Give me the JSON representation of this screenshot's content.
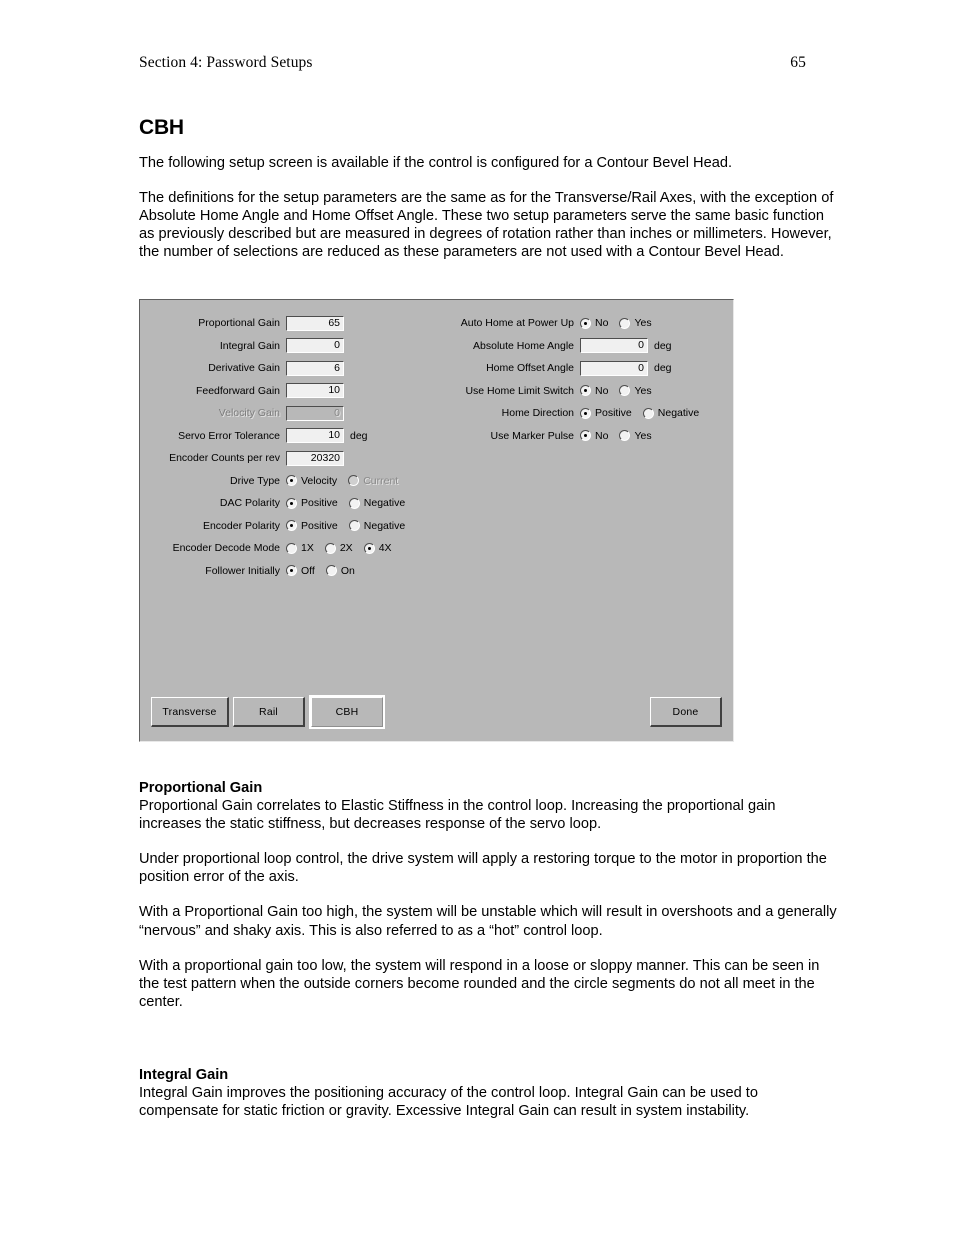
{
  "header": {
    "section": "Section 4: Password Setups",
    "page_number": "65"
  },
  "chapter_title": "CBH",
  "intro": {
    "p1": "The following setup screen is available if the control is configured for a Contour Bevel Head.",
    "p2": "The definitions for the setup parameters are the same as for the Transverse/Rail Axes, with the exception of Absolute Home Angle and Home Offset Angle.  These two setup parameters serve the same basic function as previously described but are measured in degrees of rotation rather than inches or millimeters.  However, the number of selections are reduced as these parameters are not used with a Contour Bevel Head."
  },
  "dialog": {
    "left_column": {
      "proportional_gain": {
        "label": "Proportional Gain",
        "value": "65"
      },
      "integral_gain": {
        "label": "Integral Gain",
        "value": "0"
      },
      "derivative_gain": {
        "label": "Derivative Gain",
        "value": "6"
      },
      "feedforward_gain": {
        "label": "Feedforward Gain",
        "value": "10"
      },
      "velocity_gain": {
        "label": "Velocity Gain",
        "value": "0"
      },
      "servo_error_tolerance": {
        "label": "Servo Error Tolerance",
        "value": "10",
        "unit": "deg"
      },
      "encoder_counts_per_rev": {
        "label": "Encoder Counts per rev",
        "value": "20320"
      },
      "drive_type": {
        "label": "Drive Type",
        "option1": "Velocity",
        "option2": "Current"
      },
      "dac_polarity": {
        "label": "DAC Polarity",
        "option1": "Positive",
        "option2": "Negative"
      },
      "encoder_polarity": {
        "label": "Encoder Polarity",
        "option1": "Positive",
        "option2": "Negative"
      },
      "encoder_decode_mode": {
        "label": "Encoder Decode Mode",
        "option1": "1X",
        "option2": "2X",
        "option3": "4X"
      },
      "follower_initially": {
        "label": "Follower Initially",
        "option1": "Off",
        "option2": "On"
      }
    },
    "right_column": {
      "auto_home_at_power_up": {
        "label": "Auto Home at Power Up",
        "option1": "No",
        "option2": "Yes"
      },
      "absolute_home_angle": {
        "label": "Absolute Home Angle",
        "value": "0",
        "unit": "deg"
      },
      "home_offset_angle": {
        "label": "Home Offset Angle",
        "value": "0",
        "unit": "deg"
      },
      "use_home_limit_switch": {
        "label": "Use Home Limit Switch",
        "option1": "No",
        "option2": "Yes"
      },
      "home_direction": {
        "label": "Home Direction",
        "option1": "Positive",
        "option2": "Negative"
      },
      "use_marker_pulse": {
        "label": "Use Marker Pulse",
        "option1": "No",
        "option2": "Yes"
      }
    },
    "buttons": {
      "transverse": "Transverse",
      "rail": "Rail",
      "cbh": "CBH",
      "done": "Done"
    }
  },
  "sections": {
    "proportional_gain": {
      "heading": "Proportional Gain",
      "p1": "Proportional Gain correlates to Elastic Stiffness in the control loop.  Increasing the proportional gain increases the static stiffness, but decreases response of the servo loop.",
      "p2": "Under proportional loop control, the drive system will apply a restoring torque to the motor in proportion the position error of the axis.",
      "p3": "With a Proportional Gain too high, the system will be unstable which will result in overshoots and a generally “nervous” and shaky axis.  This is also referred to as a “hot” control loop.",
      "p4": "With a proportional gain too low, the system will respond in a loose or sloppy manner.  This can be seen in the test pattern when the outside corners become rounded and the circle segments do not all meet in the center."
    },
    "integral_gain": {
      "heading": "Integral Gain",
      "p1": "Integral Gain improves the positioning accuracy of the control loop.  Integral Gain can be used to compensate for static friction or gravity.  Excessive Integral Gain can result in system instability."
    }
  }
}
